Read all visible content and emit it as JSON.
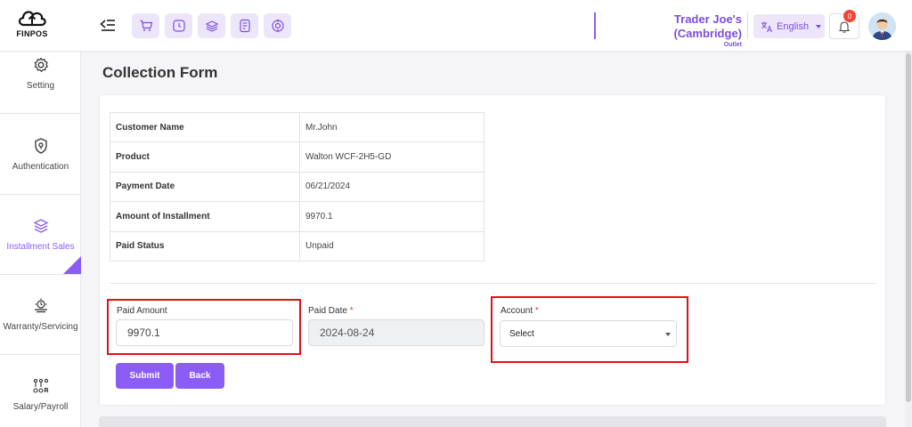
{
  "app": {
    "logo_text": "FINPOS"
  },
  "header": {
    "store_name": "Trader Joe's (Cambridge)",
    "store_type": "Outlet",
    "language": "English",
    "notification_count": "0",
    "quick_icons": [
      "cart-icon",
      "clock-icon",
      "layers-icon",
      "receipt-icon",
      "target-icon"
    ]
  },
  "sidebar": {
    "items": [
      {
        "label": "Setting",
        "icon": "gear-icon"
      },
      {
        "label": "Authentication",
        "icon": "shield-icon"
      },
      {
        "label": "Installment Sales",
        "icon": "layers-icon",
        "active": true
      },
      {
        "label": "Warranty/Servicing",
        "icon": "service-icon"
      },
      {
        "label": "Salary/Payroll",
        "icon": "payroll-icon"
      }
    ]
  },
  "page": {
    "title": "Collection Form"
  },
  "details": [
    {
      "key": "Customer Name",
      "value": "Mr.John"
    },
    {
      "key": "Product",
      "value": "Walton WCF-2H5-GD"
    },
    {
      "key": "Payment Date",
      "value": "06/21/2024"
    },
    {
      "key": "Amount of Installment",
      "value": "9970.1"
    },
    {
      "key": "Paid Status",
      "value": "Unpaid"
    }
  ],
  "form": {
    "paid_amount_label": "Paid Amount",
    "paid_amount_value": "9970.1",
    "paid_date_label": "Paid Date",
    "paid_date_value": "2024-08-24",
    "account_label": "Account",
    "account_value": "Select",
    "required_mark": "*",
    "submit_label": "Submit",
    "back_label": "Back"
  },
  "colors": {
    "accent": "#8b5cf6",
    "highlight": "#e0101a",
    "badge": "#f04438"
  }
}
